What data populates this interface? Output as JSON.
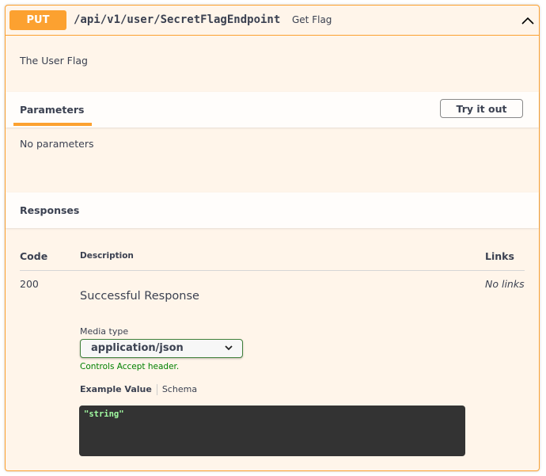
{
  "operation": {
    "method": "PUT",
    "path": "/api/v1/user/SecretFlagEndpoint",
    "summary": "Get Flag",
    "description": "The User Flag",
    "method_color": "#fca130"
  },
  "parameters": {
    "title": "Parameters",
    "try_label": "Try it out",
    "empty": "No parameters"
  },
  "responses": {
    "title": "Responses",
    "columns": {
      "code": "Code",
      "description": "Description",
      "links": "Links"
    },
    "rows": [
      {
        "code": "200",
        "description": "Successful Response",
        "links": "No links",
        "media_type_label": "Media type",
        "media_type": "application/json",
        "controls_note": "Controls Accept header.",
        "example_tab": "Example Value",
        "schema_tab": "Schema",
        "example": "\"string\""
      }
    ]
  }
}
